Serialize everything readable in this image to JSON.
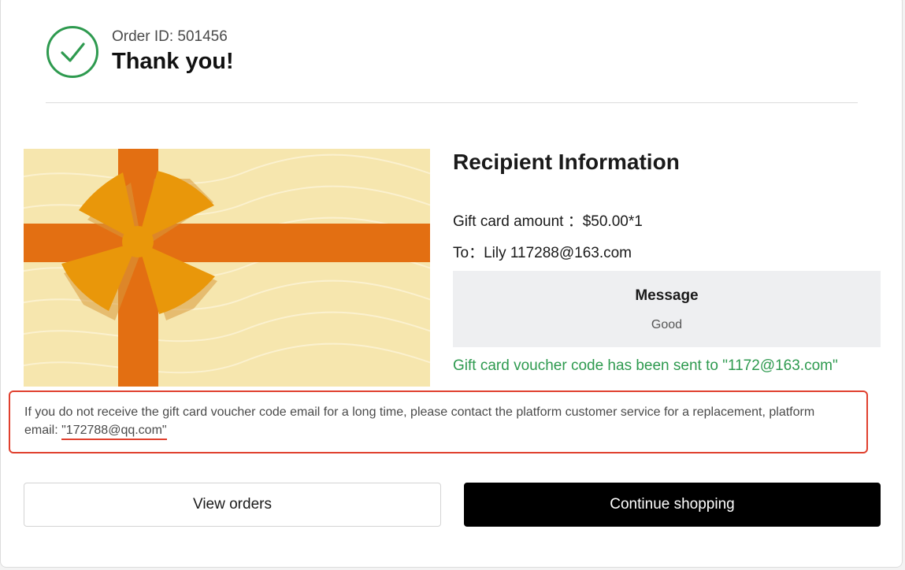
{
  "header": {
    "order_id": "Order ID: 501456",
    "title": "Thank you!"
  },
  "recipient": {
    "title": "Recipient Information",
    "amount_line": "Gift card amount ：$50.00*1",
    "to_line": "To：Lily 117288@163.com",
    "message_title": "Message",
    "message_body": "Good",
    "sent_note": "Gift card voucher code has been sent to \"1172@163.com\""
  },
  "notice": {
    "text": "If you do not receive the gift card voucher code email for a long time, please contact the platform customer service for a replacement, platform email: ",
    "email": "\"172788@qq.com\""
  },
  "actions": {
    "view_orders": "View orders",
    "continue_shopping": "Continue shopping"
  },
  "colors": {
    "success_green": "#2e9a4f",
    "highlight_red": "#e0402e",
    "ribbon_orange": "#e36f12",
    "bow_amber": "#e9970a",
    "card_cream": "#f6e6ae"
  },
  "icons": {
    "success": "check-circle-icon"
  }
}
